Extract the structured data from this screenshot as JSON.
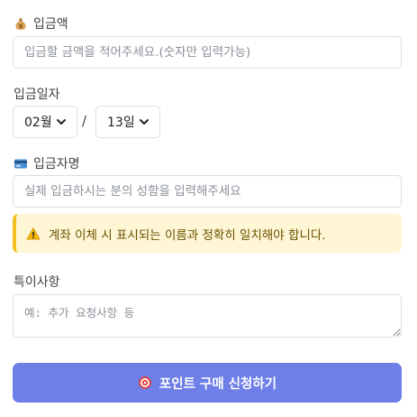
{
  "deposit_amount": {
    "icon": "money-bag-icon",
    "label": "입금액",
    "placeholder": "입금할 금액을 적어주세요.(숫자만 입력가능)",
    "value": ""
  },
  "deposit_date": {
    "label": "입금일자",
    "month_selected": "02월",
    "separator": "/",
    "day_selected": "13일"
  },
  "depositor_name": {
    "icon": "credit-card-icon",
    "label": "입금자명",
    "placeholder": "실제 입금하시는 분의 성함을 입력해주세요",
    "value": ""
  },
  "notice": {
    "icon": "warning-icon",
    "text": "계좌 이체 시 표시되는 이름과 정확히 일치해야 합니다.",
    "background": "#fff6d6",
    "accent": "#f4c020"
  },
  "special_notes": {
    "label": "특이사항",
    "placeholder": "예: 추가 요청사항 등",
    "value": ""
  },
  "submit": {
    "icon": "target-icon",
    "label": "포인트 구매 신청하기",
    "background": "#6e7fe8"
  }
}
